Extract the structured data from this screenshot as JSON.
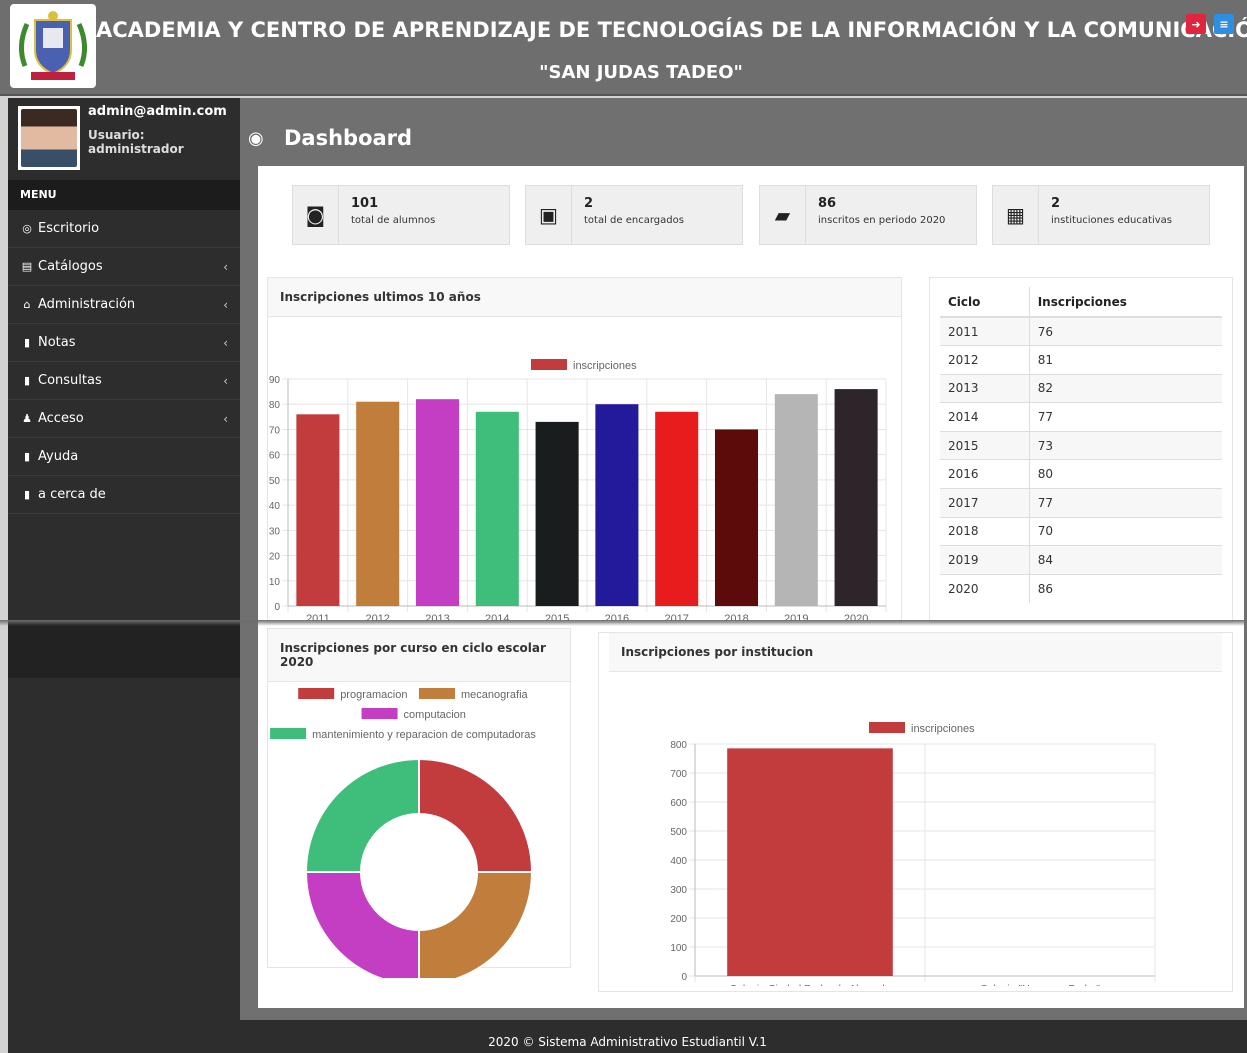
{
  "header": {
    "title_line1": "ACADEMIA Y CENTRO DE APRENDIZAJE DE TECNOLOGÍAS DE LA INFORMACIÓN Y LA COMUNICACIÓN",
    "title_line2": "\"SAN JUDAS TADEO\"",
    "logout_icon": "sign-out-icon",
    "menu_icon": "hamburger-icon",
    "logout_color": "#e0263e",
    "menu_color": "#2f8ee0"
  },
  "sidebar": {
    "email": "admin@admin.com",
    "role": "Usuario: administrador",
    "menu_heading": "MENU",
    "items": [
      {
        "label": "Escritorio",
        "icon": "dashboard-icon",
        "glyph": "◎",
        "chevron": ""
      },
      {
        "label": "Catálogos",
        "icon": "book-icon",
        "glyph": "▤",
        "chevron": "‹"
      },
      {
        "label": "Administración",
        "icon": "bank-icon",
        "glyph": "⌂",
        "chevron": "‹"
      },
      {
        "label": "Notas",
        "icon": "file-icon",
        "glyph": "▮",
        "chevron": "‹"
      },
      {
        "label": "Consultas",
        "icon": "file-icon",
        "glyph": "▮",
        "chevron": "‹"
      },
      {
        "label": "Acceso",
        "icon": "user-icon",
        "glyph": "♟",
        "chevron": "‹"
      },
      {
        "label": "Ayuda",
        "icon": "file-icon",
        "glyph": "▮",
        "chevron": ""
      },
      {
        "label": "a cerca de",
        "icon": "file-icon",
        "glyph": "▮",
        "chevron": ""
      }
    ]
  },
  "page": {
    "title": "Dashboard",
    "title_icon": "dashboard-icon"
  },
  "stats": [
    {
      "value": "101",
      "label": "total de alumnos",
      "icon": "contact-book-icon",
      "glyph": "◙"
    },
    {
      "value": "2",
      "label": "total de encargados",
      "icon": "id-card-icon",
      "glyph": "▣"
    },
    {
      "value": "86",
      "label": "inscritos en periodo 2020",
      "icon": "book-icon",
      "glyph": "▰"
    },
    {
      "value": "2",
      "label": "instituciones educativas",
      "icon": "building-icon",
      "glyph": "▦"
    }
  ],
  "bar_box": {
    "title": "Inscripciones ultimos 10 años"
  },
  "table": {
    "headers": [
      "Ciclo",
      "Inscripciones"
    ],
    "rows": [
      [
        "2011",
        "76"
      ],
      [
        "2012",
        "81"
      ],
      [
        "2013",
        "82"
      ],
      [
        "2014",
        "77"
      ],
      [
        "2015",
        "73"
      ],
      [
        "2016",
        "80"
      ],
      [
        "2017",
        "77"
      ],
      [
        "2018",
        "70"
      ],
      [
        "2019",
        "84"
      ],
      [
        "2020",
        "86"
      ]
    ]
  },
  "donut_box": {
    "title": "Inscripciones por curso en ciclo escolar 2020"
  },
  "inst_box": {
    "title": "Inscripciones por institucion"
  },
  "footer": {
    "text": "2020 © Sistema Administrativo Estudiantil V.1"
  },
  "chart_data": [
    {
      "type": "bar",
      "title": "Inscripciones ultimos 10 años",
      "legend": [
        "inscripciones"
      ],
      "legend_position": "top",
      "categories": [
        "2011",
        "2012",
        "2013",
        "2014",
        "2015",
        "2016",
        "2017",
        "2018",
        "2019",
        "2020"
      ],
      "values": [
        76,
        81,
        82,
        77,
        73,
        80,
        77,
        70,
        84,
        86
      ],
      "colors": [
        "#c23b3d",
        "#c17d3c",
        "#c43ec4",
        "#3fbd7b",
        "#1a1d1d",
        "#23199b",
        "#e81c1c",
        "#5c0a0a",
        "#b5b5b5",
        "#2e252a"
      ],
      "ylim": [
        0,
        90
      ],
      "yticks": [
        0,
        10,
        20,
        30,
        40,
        50,
        60,
        70,
        80,
        90
      ],
      "grid": true
    },
    {
      "type": "pie",
      "title": "Inscripciones por curso en ciclo escolar 2020",
      "donut": true,
      "labels": [
        "programacion",
        "mecanografia",
        "computacion",
        "mantenimiento y reparacion de computadoras"
      ],
      "values": [
        25,
        25,
        25,
        25
      ],
      "colors": [
        "#c23b3d",
        "#c17d3c",
        "#c43ec4",
        "#3fbd7b"
      ],
      "legend_position": "top"
    },
    {
      "type": "bar",
      "title": "Inscripciones por institucion",
      "legend": [
        "inscripciones"
      ],
      "legend_position": "top",
      "categories": [
        "Colegio Ciudad Pedro de Alvarado",
        "Colegio \"Hermano Pedro\""
      ],
      "values": [
        785,
        0
      ],
      "colors": [
        "#c23b3d",
        "#c23b3d"
      ],
      "ylim": [
        0,
        800
      ],
      "yticks": [
        0,
        100,
        200,
        300,
        400,
        500,
        600,
        700,
        800
      ],
      "grid": true
    }
  ]
}
